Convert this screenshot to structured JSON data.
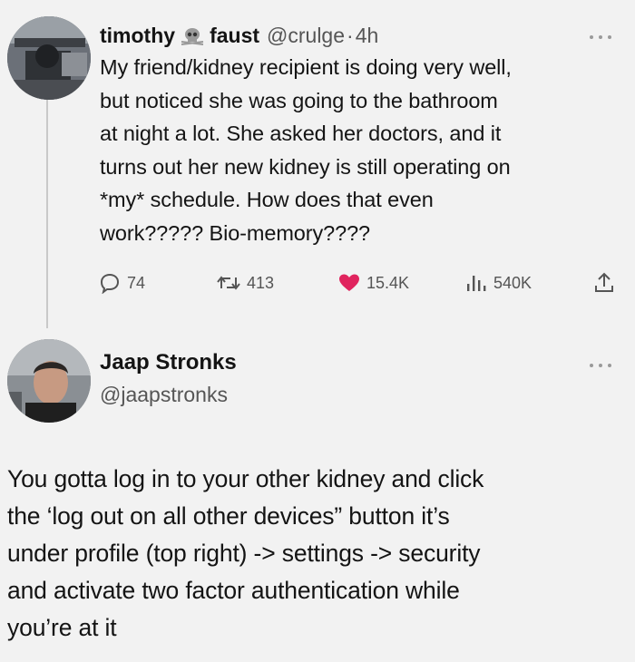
{
  "tweet": {
    "display_name_first": "timothy",
    "display_name_last": "faust",
    "handle": "@crulge",
    "separator": "·",
    "time": "4h",
    "text_lines": [
      "My friend/kidney recipient is doing very well,",
      "but noticed she was going to the bathroom",
      "at night a lot. She asked her doctors, and it",
      "turns out her new kidney is still operating on",
      "*my* schedule. How does that even",
      "work????? Bio-memory????"
    ],
    "replies": "74",
    "retweets": "413",
    "likes": "15.4K",
    "views": "540K",
    "colors": {
      "like": "#e0245e",
      "muted": "#555555"
    }
  },
  "reply": {
    "display_name": "Jaap Stronks",
    "handle": "@jaapstronks",
    "text_lines": [
      "You gotta log in to your other kidney and click",
      "the ‘log out on all other devices” button it’s",
      "under profile (top right) -> settings -> security",
      "and activate two factor authentication while",
      "you’re at it"
    ]
  },
  "icons": [
    "skull-emoji-icon",
    "more-icon",
    "reply-icon",
    "retweet-icon",
    "like-heart-icon",
    "views-icon",
    "share-icon"
  ]
}
